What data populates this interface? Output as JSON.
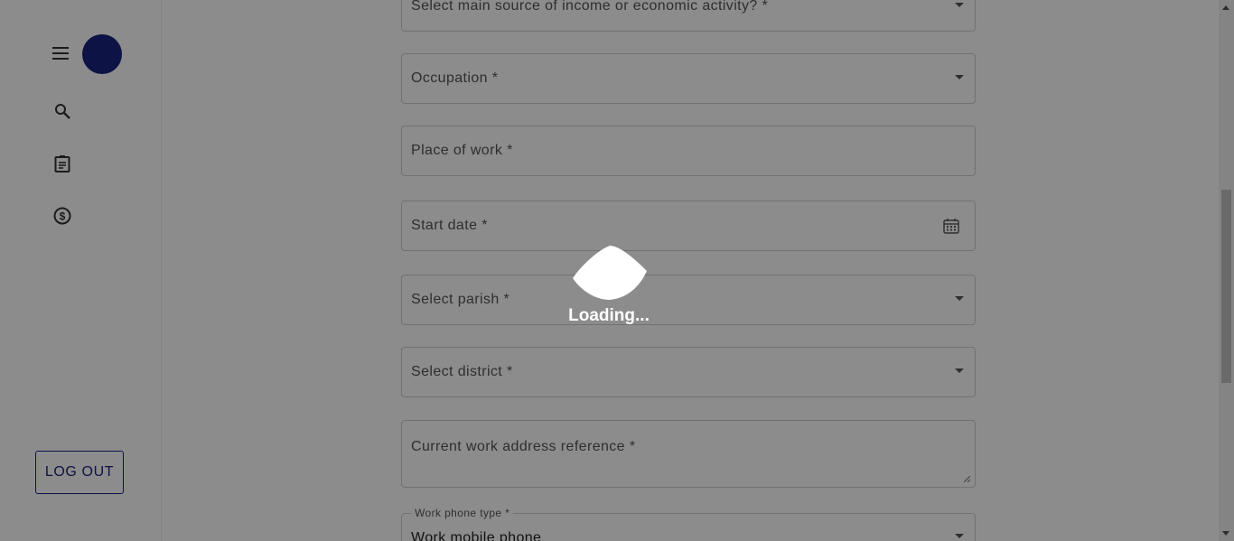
{
  "sidebar": {
    "menu_icon": "hamburger-menu-icon",
    "nav_icons": [
      "search-icon",
      "clipboard-icon",
      "dollar-circle-icon"
    ],
    "logout_label": "LOG OUT",
    "accent": "#1a237e"
  },
  "form": {
    "income_source_label": "Select main source of income or economic activity? *",
    "occupation_label": "Occupation *",
    "place_of_work_label": "Place of work *",
    "start_date_label": "Start date *",
    "parish_label": "Select parish *",
    "district_label": "Select district *",
    "work_address_label": "Current work address reference *",
    "work_phone_type_label": "Work phone type *",
    "work_phone_type_value": "Work mobile phone"
  },
  "overlay": {
    "loading_text": "Loading..."
  }
}
